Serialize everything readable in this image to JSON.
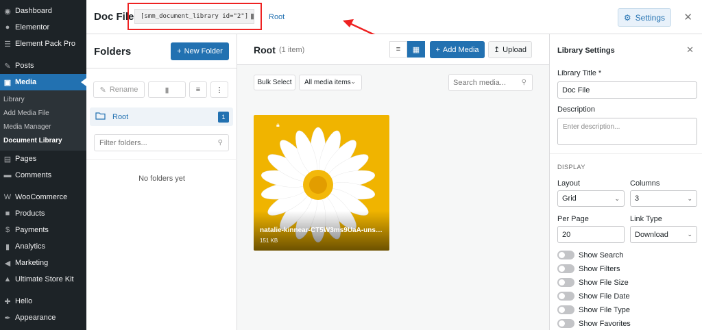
{
  "sidebar": {
    "items": [
      {
        "label": "Dashboard",
        "icon": "dashboard-icon"
      },
      {
        "label": "Elementor",
        "icon": "elementor-icon"
      },
      {
        "label": "Element Pack Pro",
        "icon": "element-pack-icon"
      },
      {
        "label": "Posts",
        "icon": "pin-icon"
      },
      {
        "label": "Media",
        "icon": "media-icon"
      },
      {
        "label": "Pages",
        "icon": "pages-icon"
      },
      {
        "label": "Comments",
        "icon": "comments-icon"
      },
      {
        "label": "WooCommerce",
        "icon": "woocommerce-icon"
      },
      {
        "label": "Products",
        "icon": "products-icon"
      },
      {
        "label": "Payments",
        "icon": "payments-icon"
      },
      {
        "label": "Analytics",
        "icon": "analytics-icon"
      },
      {
        "label": "Marketing",
        "icon": "marketing-icon"
      },
      {
        "label": "Ultimate Store Kit",
        "icon": "store-kit-icon"
      },
      {
        "label": "Hello",
        "icon": "hello-icon"
      },
      {
        "label": "Appearance",
        "icon": "appearance-icon"
      }
    ],
    "media_sub": [
      "Library",
      "Add Media File",
      "Media Manager",
      "Document Library"
    ]
  },
  "topbar": {
    "title": "Doc File",
    "shortcode": "[smm_document_library id=\"2\"]",
    "breadcrumb": "Root",
    "settings_label": "Settings"
  },
  "folders": {
    "title": "Folders",
    "new_folder_label": "New Folder",
    "rename_label": "Rename",
    "root_label": "Root",
    "root_count": "1",
    "filter_placeholder": "Filter folders...",
    "empty_text": "No folders yet"
  },
  "main": {
    "title": "Root",
    "count": "(1 item)",
    "add_media_label": "Add Media",
    "upload_label": "Upload",
    "bulk_select_label": "Bulk Select",
    "media_filter_value": "All media items",
    "search_placeholder": "Search media...",
    "file": {
      "name": "natalie-kinnear-CT5W3ms9UaA-uns…",
      "size": "151 KB"
    }
  },
  "settings": {
    "title": "Library Settings",
    "library_title_label": "Library Title *",
    "library_title_value": "Doc File",
    "description_label": "Description",
    "description_placeholder": "Enter description...",
    "display_heading": "DISPLAY",
    "layout_label": "Layout",
    "layout_value": "Grid",
    "columns_label": "Columns",
    "columns_value": "3",
    "per_page_label": "Per Page",
    "per_page_value": "20",
    "link_type_label": "Link Type",
    "link_type_value": "Download",
    "toggles": [
      "Show Search",
      "Show Filters",
      "Show File Size",
      "Show File Date",
      "Show File Type",
      "Show Favorites"
    ]
  },
  "colors": {
    "accent": "#2271b1",
    "sidebar_bg": "#1d2327",
    "highlight_box": "#ee2222",
    "card_bg": "#f0b400"
  }
}
